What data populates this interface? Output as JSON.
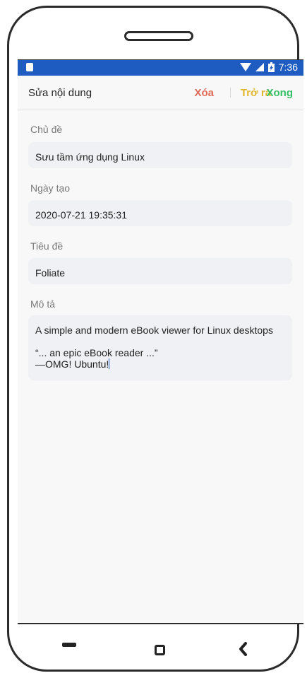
{
  "status_bar": {
    "time": "7:36"
  },
  "app_bar": {
    "title": "Sửa nội dung",
    "delete_label": "Xóa",
    "back_label": "Trở ra",
    "done_label": "Xong"
  },
  "form": {
    "topic_label": "Chủ đề",
    "topic_value": "Sưu tầm ứng dụng Linux",
    "created_label": "Ngày tạo",
    "created_value": "2020-07-21 19:35:31",
    "title_label": "Tiêu đề",
    "title_value": "Foliate",
    "description_label": "Mô tả",
    "description_lines": [
      "A simple and modern eBook viewer for Linux desktops",
      "",
      "“... an epic eBook reader ...”",
      "—OMG! Ubuntu!"
    ]
  },
  "colors": {
    "status_bar": "#1e5cc1",
    "delete": "#e06b57",
    "back": "#e2b72b",
    "done": "#34c063"
  }
}
